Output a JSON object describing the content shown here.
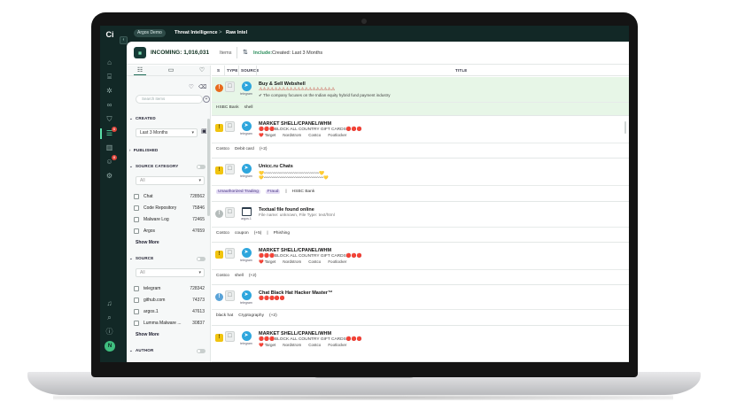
{
  "rail": {
    "logo": "Ci",
    "icons": [
      "home-icon",
      "bank-icon",
      "bug-icon",
      "link-icon",
      "shield-icon",
      "pulse-icon",
      "bar-chart-icon",
      "people-icon",
      "gear-icon"
    ],
    "badges": [
      "6",
      "8"
    ],
    "bottom_icons": [
      "bell-icon",
      "search-icon",
      "info-icon"
    ],
    "avatar": "N"
  },
  "topbar": {
    "workspace": "Argos Demo",
    "crumb_1": "Threat Intelligence",
    "separator": ">",
    "crumb_2": "Raw Intel"
  },
  "header": {
    "incoming_label": "INCOMING: 1,016,031",
    "items_label": "Items",
    "include_label": "Include:",
    "created_label": "Created: Last 3 Months"
  },
  "sidebar": {
    "search_placeholder": "Search items",
    "created_title": "CREATED",
    "created_value": "Last 3 Months",
    "published_title": "PUBLISHED",
    "source_category_title": "SOURCE CATEGORY",
    "source_category_select": "All",
    "source_category_items": [
      {
        "label": "Chat",
        "count": "728562"
      },
      {
        "label": "Code Repository",
        "count": "75846"
      },
      {
        "label": "Malware Log",
        "count": "72465"
      },
      {
        "label": "Argos",
        "count": "47659"
      }
    ],
    "show_more": "Show More",
    "source_title": "SOURCE",
    "source_select": "All",
    "source_items": [
      {
        "label": "telegram",
        "count": "728342"
      },
      {
        "label": "github.com",
        "count": "74373"
      },
      {
        "label": "argos.1",
        "count": "47613"
      },
      {
        "label": "Lumma Malware ...",
        "count": "30837"
      }
    ],
    "author_title": "AUTHOR"
  },
  "table": {
    "col_s": "S",
    "col_type": "TYPE",
    "col_source": "SOURCE",
    "col_title": "TITLE",
    "rows": [
      {
        "title": "Buy & Sell Webshell",
        "line2": "⚠⚠⚠⚠⚠⚠⚠⚠⚠⚠⚠⚠⚠⚠⚠⚠⚠⚠⚠⚠",
        "line3": "✔ The company focuses on the Indian equity hybrid fund payment industry",
        "source": "telegram",
        "tags": [
          "HSBC Bank",
          "shell"
        ]
      },
      {
        "title": "MARKET SHELL/CPANEL/WHM",
        "line2": "🔴🔴🔴BLOCK  ALL COUNTRY GIFT CARDS🔴🔴🔴",
        "line3": [
          "❤️ Target",
          "Nordstrom",
          "Costco",
          "Footlocker"
        ],
        "source": "telegram",
        "tags": [
          "Costco",
          "Debit card",
          "(+2)"
        ]
      },
      {
        "title": "Unicc.ru Chats",
        "line2": "💛〰〰〰〰〰〰〰〰〰〰〰〰〰💛",
        "line3": "💛〰〰〰〰〰〰〰〰〰〰〰〰〰〰〰💛",
        "source": "telegram",
        "tags": [
          "Unauthorized Trading",
          "Fraud",
          "|",
          "HSBC Bank"
        ]
      },
      {
        "title": "Textual file found online",
        "line2": "File name: unknown, File Type: text/html",
        "source": "argos.1",
        "tags": [
          "Costco",
          "coupon",
          "(+5)",
          "|",
          "Phishing"
        ]
      },
      {
        "title": "MARKET SHELL/CPANEL/WHM",
        "line2": "🔴🔴🔴BLOCK  ALL COUNTRY GIFT CARDS🔴🔴🔴",
        "line3": [
          "❤️ Target",
          "Nordstrom",
          "Costco",
          "Footlocker"
        ],
        "source": "telegram",
        "tags": [
          "Costco",
          "shell",
          "(+2)"
        ]
      },
      {
        "title": "Chat Black Hat Hacker Master™",
        "line2": "🔴🔴🔴🔴🔴",
        "source": "telegram",
        "tags": [
          "black hat",
          "Cryptography",
          "(+2)"
        ]
      },
      {
        "title": "MARKET SHELL/CPANEL/WHM",
        "line2": "🔴🔴🔴BLOCK  ALL COUNTRY GIFT CARDS🔴🔴🔴",
        "line3": [
          "❤️ Target",
          "Nordstrom",
          "Costco",
          "Footlocker"
        ],
        "source": "telegram",
        "tags": []
      }
    ]
  },
  "colors": {
    "rail_bg": "#122826",
    "accent": "#5be0a8",
    "highlight_row": "#e7f6e7",
    "telegram": "#2ea6dd",
    "severity_high": "#e86a1c",
    "severity_medium": "#f1c40f"
  }
}
